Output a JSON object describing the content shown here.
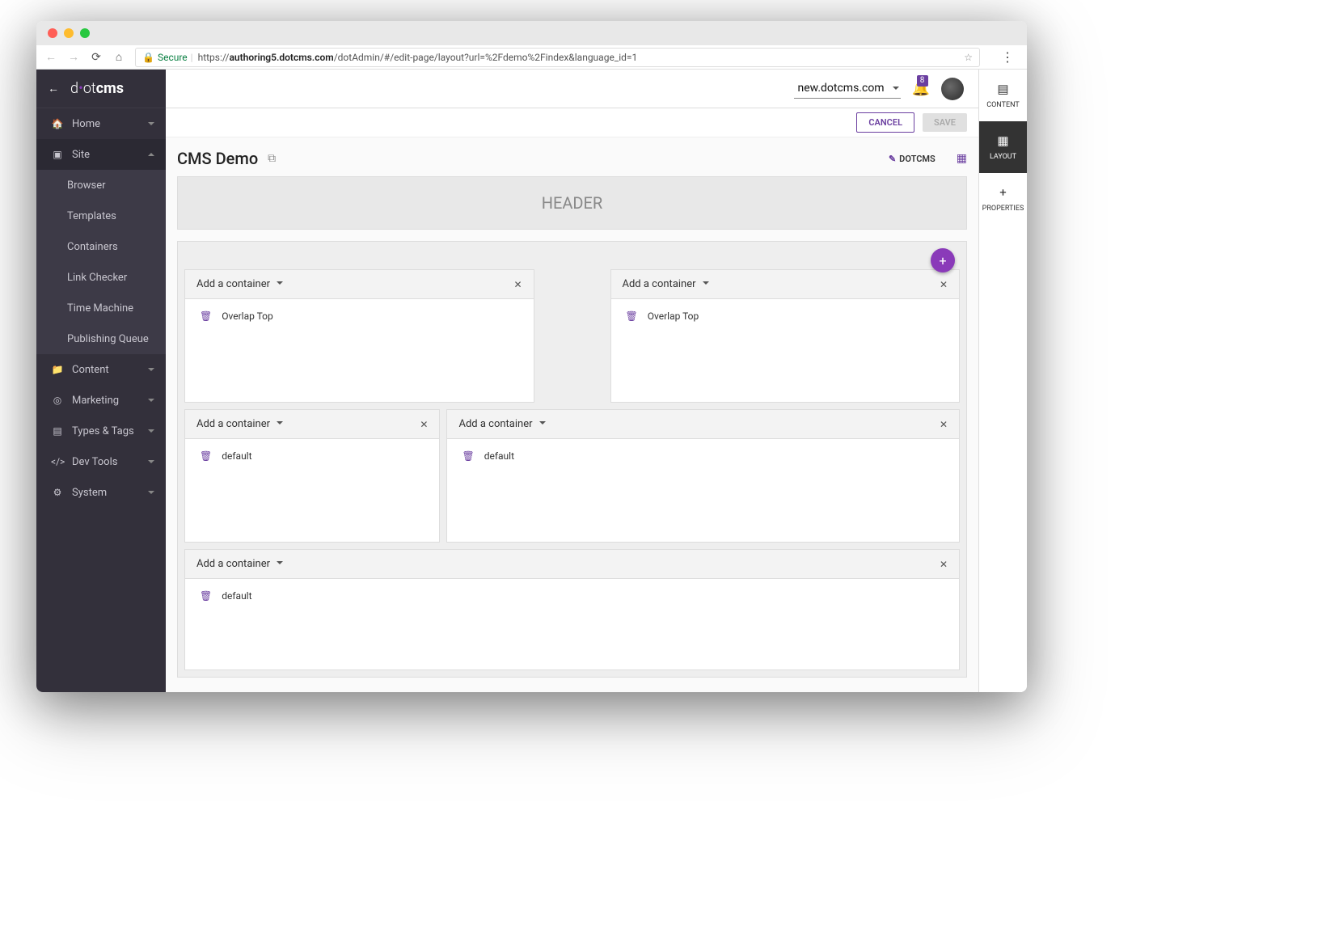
{
  "url": {
    "secure_label": "Secure",
    "host_bold": "authoring5.dotcms.com",
    "prefix": "https://",
    "path": "/dotAdmin/#/edit-page/layout?url=%2Fdemo%2Findex&language_id=1"
  },
  "logo": {
    "d": "d",
    "ot": "ot",
    "cms": "cms"
  },
  "sidebar": {
    "items": [
      {
        "label": "Home"
      },
      {
        "label": "Site"
      },
      {
        "label": "Content"
      },
      {
        "label": "Marketing"
      },
      {
        "label": "Types & Tags"
      },
      {
        "label": "Dev Tools"
      },
      {
        "label": "System"
      }
    ],
    "site_children": [
      {
        "label": "Browser"
      },
      {
        "label": "Templates"
      },
      {
        "label": "Containers"
      },
      {
        "label": "Link Checker"
      },
      {
        "label": "Time Machine"
      },
      {
        "label": "Publishing Queue"
      }
    ]
  },
  "topbar": {
    "site_selected": "new.dotcms.com",
    "notification_count": "8"
  },
  "toolbar": {
    "cancel": "CANCEL",
    "save": "SAVE"
  },
  "page": {
    "title": "CMS Demo",
    "template_tag": "DOTCMS",
    "header_label": "HEADER",
    "add_container": "Add a container",
    "containers": [
      {
        "item": "Overlap Top"
      },
      {
        "item": "Overlap Top"
      },
      {
        "item": "default"
      },
      {
        "item": "default"
      },
      {
        "item": "default"
      }
    ]
  },
  "rail": {
    "content": "CONTENT",
    "layout": "LAYOUT",
    "properties": "PROPERTIES"
  }
}
